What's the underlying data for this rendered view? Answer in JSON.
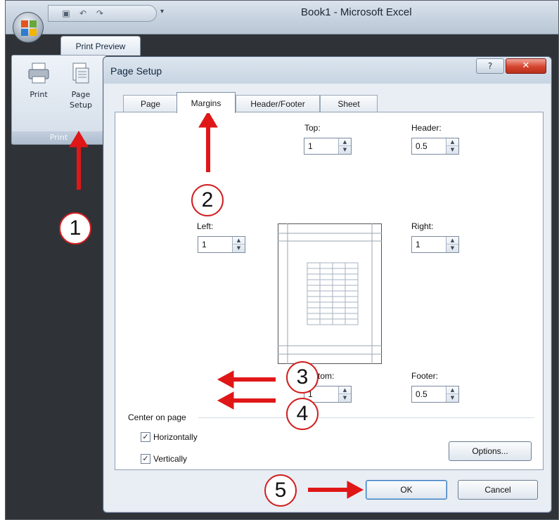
{
  "window": {
    "title": "Book1 - Microsoft Excel",
    "qat_items": [
      "save-icon",
      "undo-icon",
      "redo-icon"
    ],
    "ribbon_tab": "Print Preview",
    "ribbon_group_label": "Print",
    "print_label": "Print",
    "page_setup_label_line1": "Page",
    "page_setup_label_line2": "Setup"
  },
  "dialog": {
    "title": "Page Setup",
    "help_label": "?",
    "close_label": "✕",
    "tabs": [
      "Page",
      "Margins",
      "Header/Footer",
      "Sheet"
    ],
    "active_tab": "Margins",
    "fields": {
      "top": {
        "label": "Top:",
        "value": "1"
      },
      "header": {
        "label": "Header:",
        "value": "0.5"
      },
      "left": {
        "label": "Left:",
        "value": "1"
      },
      "right": {
        "label": "Right:",
        "value": "1"
      },
      "bottom": {
        "label": "Bottom:",
        "value": "1"
      },
      "footer": {
        "label": "Footer:",
        "value": "0.5"
      }
    },
    "center_on_page": {
      "label": "Center on page",
      "horizontally": {
        "label": "Horizontally",
        "checked": true
      },
      "vertically": {
        "label": "Vertically",
        "checked": true
      }
    },
    "buttons": {
      "options": "Options...",
      "ok": "OK",
      "cancel": "Cancel"
    }
  },
  "annotations": [
    "1",
    "2",
    "3",
    "4",
    "5"
  ],
  "colors": {
    "annotation": "#e01717",
    "dialog_bg": "#e9eef4",
    "excel_bg": "#2f3338"
  }
}
